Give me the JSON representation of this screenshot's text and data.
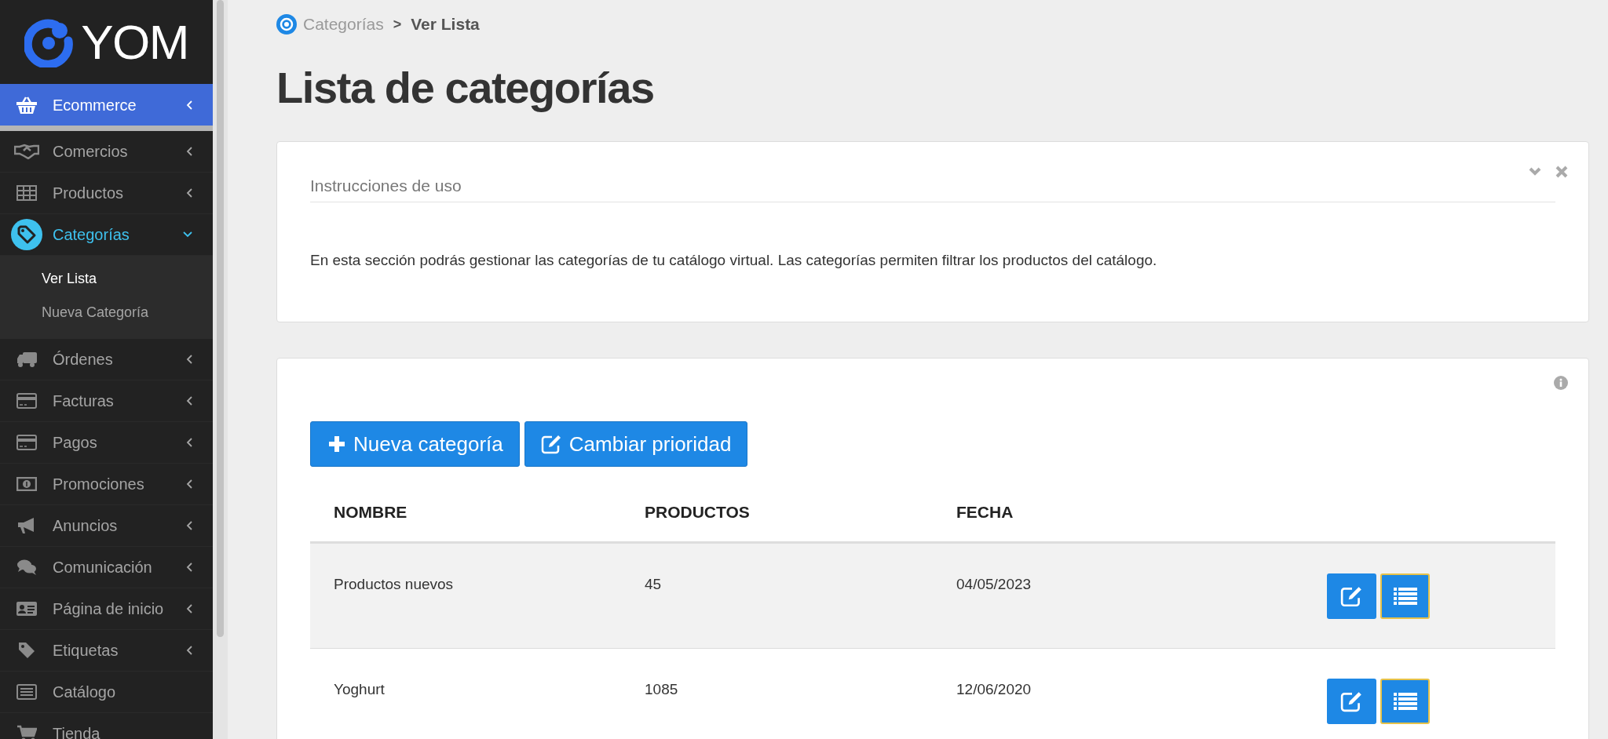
{
  "sidebar": {
    "logo": "YOM",
    "items": [
      {
        "label": "Ecommerce",
        "selected": true,
        "expanded": false,
        "caret": true
      },
      {
        "label": "Comercios",
        "selected": false,
        "expanded": false,
        "caret": true
      },
      {
        "label": "Productos",
        "selected": false,
        "expanded": false,
        "caret": true
      },
      {
        "label": "Categorías",
        "selected": false,
        "expanded": true,
        "caret": true,
        "children": [
          {
            "label": "Ver Lista",
            "selected": true
          },
          {
            "label": "Nueva Categoría",
            "selected": false
          }
        ]
      },
      {
        "label": "Órdenes",
        "selected": false,
        "expanded": false,
        "caret": true
      },
      {
        "label": "Facturas",
        "selected": false,
        "expanded": false,
        "caret": true
      },
      {
        "label": "Pagos",
        "selected": false,
        "expanded": false,
        "caret": true
      },
      {
        "label": "Promociones",
        "selected": false,
        "expanded": false,
        "caret": true
      },
      {
        "label": "Anuncios",
        "selected": false,
        "expanded": false,
        "caret": true
      },
      {
        "label": "Comunicación",
        "selected": false,
        "expanded": false,
        "caret": true
      },
      {
        "label": "Página de inicio",
        "selected": false,
        "expanded": false,
        "caret": true
      },
      {
        "label": "Etiquetas",
        "selected": false,
        "expanded": false,
        "caret": true
      },
      {
        "label": "Catálogo",
        "selected": false,
        "expanded": false,
        "caret": false
      },
      {
        "label": "Tienda",
        "selected": false,
        "expanded": false,
        "caret": false
      }
    ]
  },
  "breadcrumb": [
    {
      "label": "Categorías",
      "selected": false
    },
    {
      "label": "Ver Lista",
      "selected": true
    }
  ],
  "breadcrumb_separator": ">",
  "page_title": "Lista de categorías",
  "instructions": {
    "title": "Instrucciones de uso",
    "text": "En esta sección podrás gestionar las categorías de tu catálogo virtual. Las categorías permiten filtrar los productos del catálogo."
  },
  "list": {
    "buttons": [
      {
        "label": "Nueva categoría",
        "kind": "add"
      },
      {
        "label": "Cambiar prioridad",
        "kind": "edit"
      }
    ],
    "columns": [
      "NOMBRE",
      "PRODUCTOS",
      "FECHA"
    ],
    "rows": [
      {
        "cells": [
          "Productos nuevos",
          "45",
          "04/05/2023"
        ],
        "selected": true
      },
      {
        "cells": [
          "Yoghurt",
          "1085",
          "12/06/2020"
        ],
        "selected": false
      }
    ]
  }
}
